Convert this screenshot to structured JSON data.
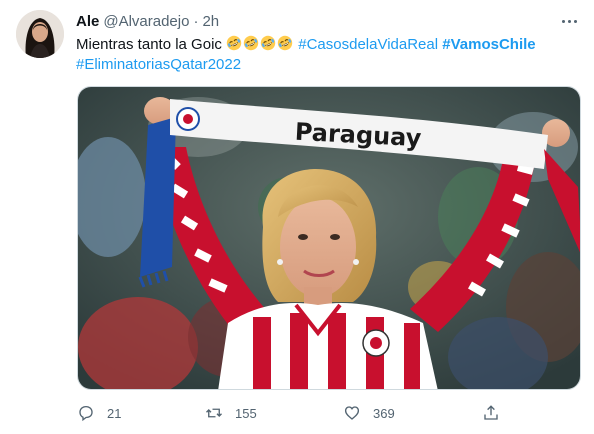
{
  "tweet": {
    "author": {
      "name": "Ale",
      "handle": "@Alvaradejo",
      "separator": "·",
      "time": "2h"
    },
    "text": {
      "prefix": "Mientras tanto la Goic ",
      "emoji_name": "rolling-on-floor-laughing",
      "emoji_count": 4,
      "hashtags": [
        {
          "text": "#CasosdelaVidaReal",
          "bold": false
        },
        {
          "text": "#VamosChile",
          "bold": true
        },
        {
          "text": "#EliminatoriasQatar2022",
          "bold": false
        }
      ]
    },
    "media": {
      "scarf_text": "Paraguay"
    },
    "actions": {
      "reply_count": "21",
      "retweet_count": "155",
      "like_count": "369"
    }
  },
  "colors": {
    "link": "#1d9bf0",
    "secondary_text": "#536471",
    "primary_text": "#0f1419",
    "jersey_red": "#c8102e",
    "scarf_blue": "#1f4fa8"
  },
  "icons": [
    "more-icon",
    "reply-icon",
    "retweet-icon",
    "like-icon",
    "share-icon",
    "rofl-emoji"
  ]
}
